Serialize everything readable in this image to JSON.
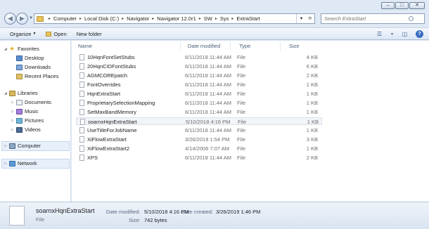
{
  "window": {
    "controls": [
      "–",
      "□",
      "✕"
    ]
  },
  "address_bar": {
    "crumbs": [
      "Computer",
      "Local Disk (C:)",
      "Navigator",
      "Navigator 12.0r1",
      "SW",
      "Sys",
      "ExtraStart"
    ],
    "search_placeholder": "Search ExtraStart"
  },
  "toolbar": {
    "organize": "Organize",
    "open": "Open",
    "new_folder": "New folder"
  },
  "nav": {
    "favorites": "Favorites",
    "desktop": "Desktop",
    "downloads": "Downloads",
    "recent": "Recent Places",
    "libraries": "Libraries",
    "documents": "Documents",
    "music": "Music",
    "pictures": "Pictures",
    "videos": "Videos",
    "computer": "Computer",
    "network": "Network"
  },
  "columns": {
    "name": "Name",
    "date": "Date modified",
    "type": "Type",
    "size": "Size"
  },
  "files": [
    {
      "name": "10HqnFontSetStubs",
      "date": "6/11/2018 11:44 AM",
      "type": "File",
      "size": "4 KB"
    },
    {
      "name": "20HqnCIDFontStubs",
      "date": "6/11/2018 11:44 AM",
      "type": "File",
      "size": "6 KB"
    },
    {
      "name": "AGMCOREpatch",
      "date": "6/11/2018 11:44 AM",
      "type": "File",
      "size": "2 KB"
    },
    {
      "name": "FontOverrides",
      "date": "6/11/2018 11:44 AM",
      "type": "File",
      "size": "1 KB"
    },
    {
      "name": "HqnExtraStart",
      "date": "6/11/2018 11:44 AM",
      "type": "File",
      "size": "1 KB"
    },
    {
      "name": "ProprietarySelectionMapping",
      "date": "6/11/2018 11:44 AM",
      "type": "File",
      "size": "1 KB"
    },
    {
      "name": "SetMaxBandMemory",
      "date": "6/11/2018 11:44 AM",
      "type": "File",
      "size": "1 KB"
    },
    {
      "name": "soarnxHqnExtraStart",
      "date": "5/10/2018 4:16 PM",
      "type": "File",
      "size": "1 KB"
    },
    {
      "name": "UseTitleForJobName",
      "date": "6/11/2018 11:44 AM",
      "type": "File",
      "size": "1 KB"
    },
    {
      "name": "XiFlowExtraStart",
      "date": "3/26/2019 1:54 PM",
      "type": "File",
      "size": "3 KB"
    },
    {
      "name": "XiFlowExtraStart2",
      "date": "4/14/2006 7:07 AM",
      "type": "File",
      "size": "1 KB"
    },
    {
      "name": "XPS",
      "date": "6/11/2018 11:44 AM",
      "type": "File",
      "size": "2 KB"
    }
  ],
  "details": {
    "name": "soarnxHqnExtraStart",
    "type": "File",
    "modified_label": "Date modified:",
    "modified_value": "5/10/2018 4:16 PM",
    "created_label": "Date created:",
    "created_value": "3/26/2019 1:46 PM",
    "size_label": "Size:",
    "size_value": "742 bytes"
  }
}
